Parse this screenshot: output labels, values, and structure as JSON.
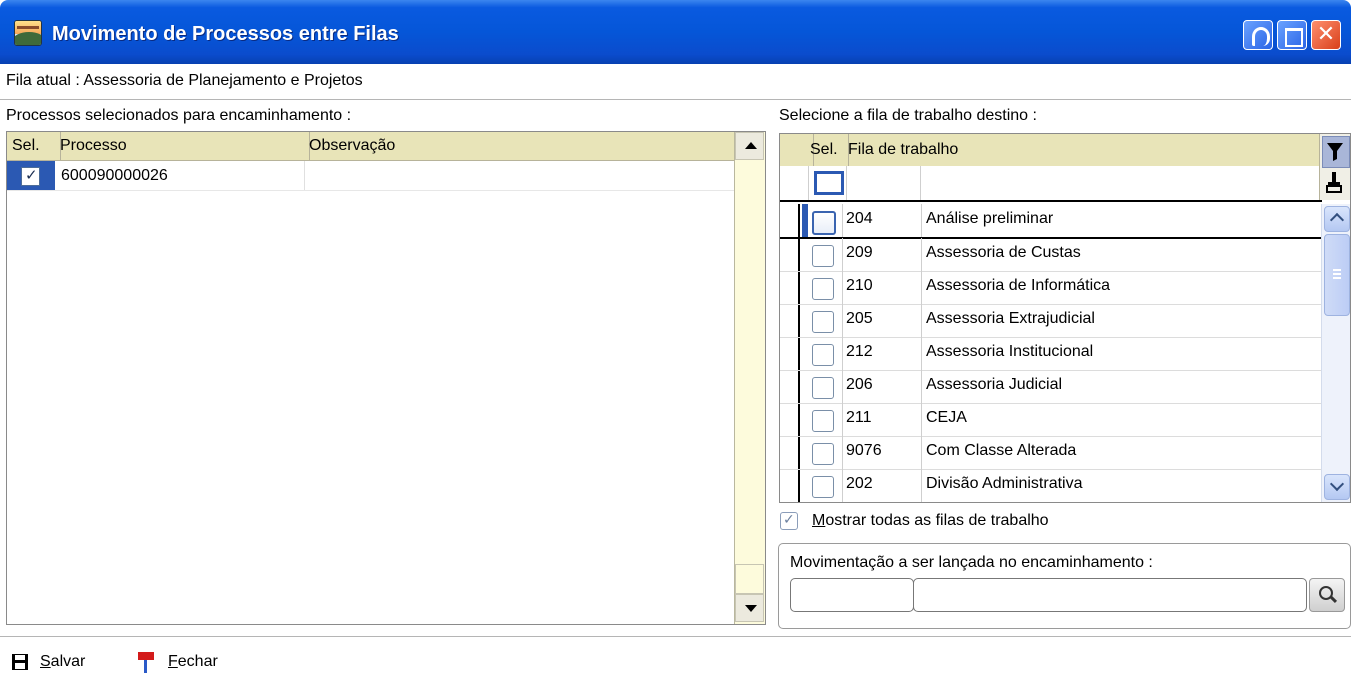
{
  "window": {
    "title": "Movimento de Processos entre Filas"
  },
  "current_queue": {
    "label": "Fila atual : Assessoria de Planejamento e Projetos"
  },
  "left_panel": {
    "label": "Processos selecionados para encaminhamento :",
    "columns": [
      "Sel.",
      "Processo",
      "Observação"
    ],
    "rows": [
      {
        "selected": true,
        "processo": "600090000026",
        "observacao": ""
      }
    ]
  },
  "right_panel": {
    "label": "Selecione a fila de trabalho destino :",
    "columns": [
      "Sel.",
      "Fila de trabalho"
    ],
    "filter_value": "",
    "rows": [
      {
        "code": "204",
        "name": "Análise preliminar",
        "selected": false
      },
      {
        "code": "209",
        "name": "Assessoria de Custas",
        "selected": false
      },
      {
        "code": "210",
        "name": "Assessoria de Informática",
        "selected": false
      },
      {
        "code": "205",
        "name": "Assessoria Extrajudicial",
        "selected": false
      },
      {
        "code": "212",
        "name": "Assessoria Institucional",
        "selected": false
      },
      {
        "code": "206",
        "name": "Assessoria Judicial",
        "selected": false
      },
      {
        "code": "211",
        "name": "CEJA",
        "selected": false
      },
      {
        "code": "9076",
        "name": "Com Classe Alterada",
        "selected": false
      },
      {
        "code": "202",
        "name": "Divisão Administrativa",
        "selected": false
      }
    ],
    "show_all": {
      "checked": true,
      "label_prefix": "M",
      "label_rest": "ostrar todas as filas de trabalho"
    }
  },
  "movement_group": {
    "label": "Movimentação a ser lançada no encaminhamento :",
    "code_value": "",
    "description_value": ""
  },
  "toolbar": {
    "save_prefix": "S",
    "save_rest": "alvar",
    "close_prefix": "F",
    "close_rest": "echar"
  },
  "colors": {
    "titlebar": "#0556d8",
    "grid_header": "#e8e4b8",
    "left_scroll_track": "#fdfbdc",
    "selection": "#2b59b3"
  }
}
